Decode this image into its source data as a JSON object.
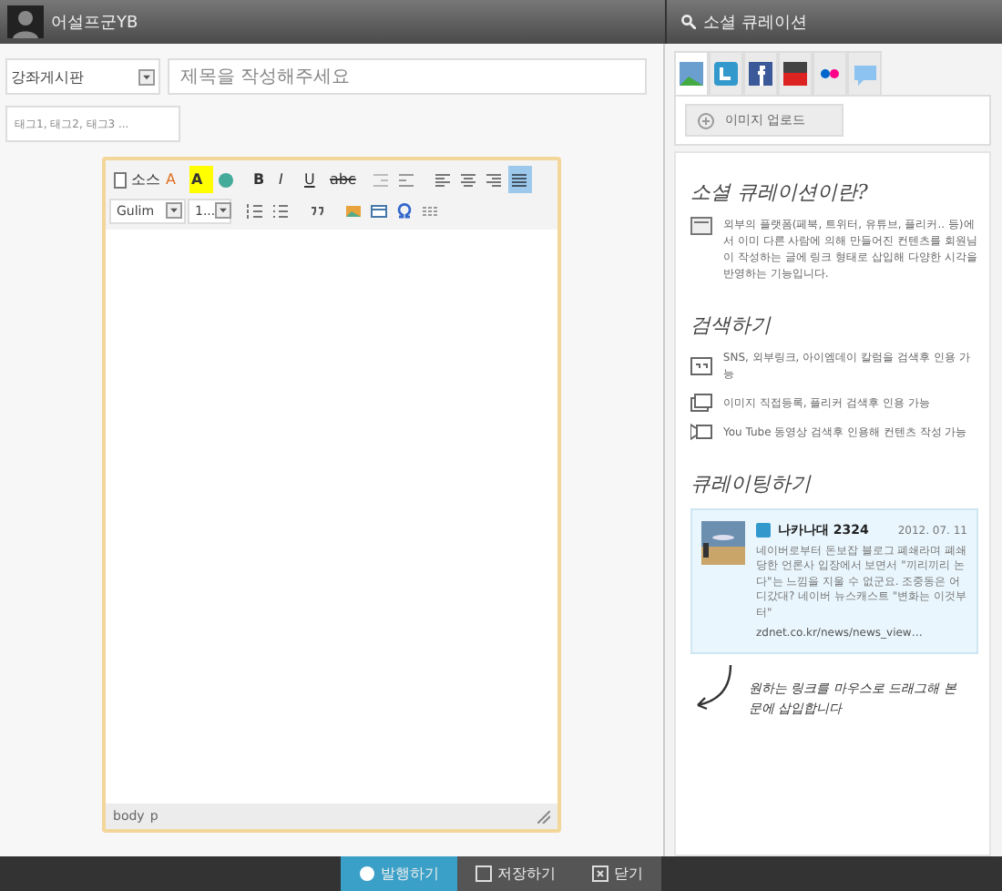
{
  "header": {
    "user": "어설프군YB"
  },
  "post": {
    "category": "강좌게시판",
    "title_placeholder": "제목을 작성해주세요",
    "tags_placeholder": "태그1, 태그2, 태그3 ..."
  },
  "editor": {
    "source": "소스",
    "font_color": "A",
    "highlight": "A",
    "bold": "B",
    "italic": "I",
    "underline": "U",
    "strike": "abc",
    "aligns": [
      {
        "selected": false
      },
      {
        "selected": false
      },
      {
        "selected": false
      },
      {
        "selected": true
      }
    ],
    "font": "Gulim",
    "size": "1...",
    "path": [
      "body",
      "p"
    ]
  },
  "panel": {
    "title": "소셜 큐레이션",
    "tabs": [
      {
        "selected": true
      },
      {
        "selected": false
      },
      {
        "selected": false
      },
      {
        "selected": false
      },
      {
        "selected": false
      },
      {
        "selected": false
      }
    ],
    "upload_button": "이미지 업로드",
    "intro": {
      "heading": "소셜 큐레이션이란?",
      "text": "외부의 플랫폼(페북, 트위터, 유튜브, 플리커.. 등)에서 이미 다른 사람에 의해 만들어진 컨텐츠를 회원님이 작성하는 글에 링크 형태로 삽입해 다양한 시각을 반영하는 기능입니다."
    },
    "search": {
      "heading": "검색하기",
      "items": [
        "SNS, 외부링크, 아이엠데이 칼럼을 검색후 인용 가능",
        "이미지 직접등록, 플리커 검색후 인용 가능",
        "You Tube 동영상 검색후 인용해 컨텐츠 작성 가능"
      ]
    },
    "curate": {
      "heading": "큐레이팅하기",
      "card": {
        "author": "나카나대 2324",
        "date": "2012. 07. 11",
        "text": "네이버로부터 돈보잡 블로그 폐쇄라며 폐쇄당한 언론사 입장에서 보면서 \"끼리끼리 논다\"는 느낌을 지울 수 없군요. 조중동은 어디갔대? 네이버 뉴스캐스트 \"변화는 이것부터\"",
        "link": "zdnet.co.kr/news/news_view…"
      },
      "hint": "원하는 링크를 마우스로 드래그해 본문에 삽입합니다"
    }
  },
  "footer": [
    {
      "label": "발행하기",
      "selected": true
    },
    {
      "label": "저장하기",
      "selected": false
    },
    {
      "label": "닫기",
      "selected": false
    }
  ]
}
